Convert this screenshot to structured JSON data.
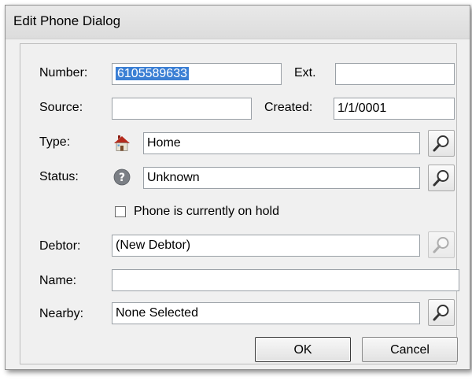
{
  "window": {
    "title": "Edit Phone Dialog"
  },
  "form": {
    "number": {
      "label": "Number:",
      "value": "6105589633"
    },
    "ext": {
      "label": "Ext.",
      "value": ""
    },
    "source": {
      "label": "Source:",
      "value": ""
    },
    "created": {
      "label": "Created:",
      "value": "1/1/0001"
    },
    "type": {
      "label": "Type:",
      "value": "Home",
      "icon": "home-icon"
    },
    "status": {
      "label": "Status:",
      "value": "Unknown",
      "icon": "question-icon"
    },
    "on_hold": {
      "label": "Phone is currently on hold",
      "checked": false
    },
    "debtor": {
      "label": "Debtor:",
      "value": "(New Debtor)"
    },
    "name": {
      "label": "Name:",
      "value": ""
    },
    "nearby": {
      "label": "Nearby:",
      "value": "None Selected"
    }
  },
  "buttons": {
    "ok": "OK",
    "cancel": "Cancel"
  },
  "colors": {
    "selection": "#3b7fd4",
    "dialog_bg": "#f0f0f0"
  }
}
